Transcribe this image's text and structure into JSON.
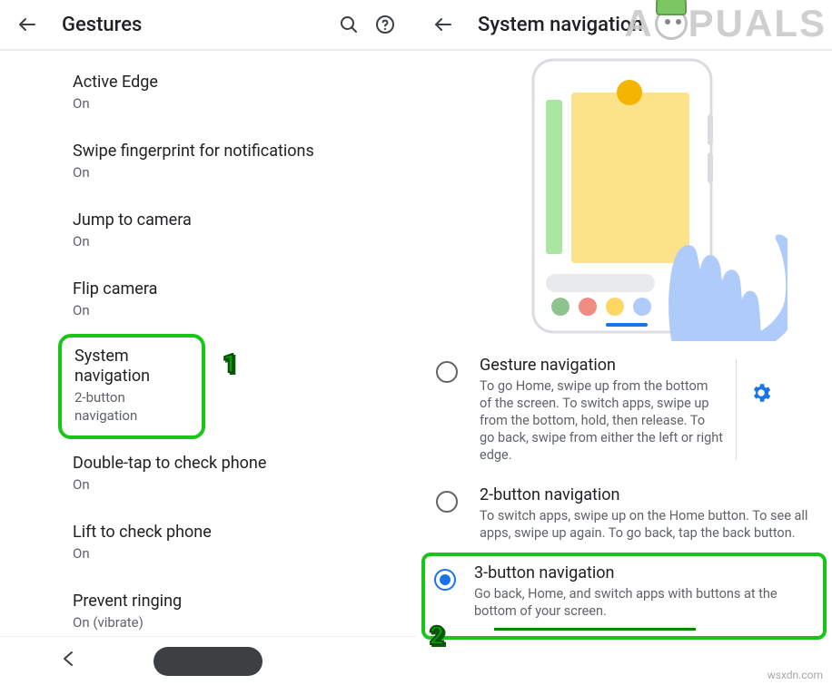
{
  "watermark": {
    "pre": "A",
    "post": "PUALS"
  },
  "footer_url": "wsxdn.com",
  "step_labels": {
    "one": "1",
    "two": "2"
  },
  "left": {
    "title": "Gestures",
    "items": [
      {
        "label": "Active Edge",
        "sub": "On"
      },
      {
        "label": "Swipe fingerprint for notifications",
        "sub": "On"
      },
      {
        "label": "Jump to camera",
        "sub": "On"
      },
      {
        "label": "Flip camera",
        "sub": "On"
      },
      {
        "label": "System navigation",
        "sub": "2-button navigation",
        "highlight": true
      },
      {
        "label": "Double-tap to check phone",
        "sub": "On"
      },
      {
        "label": "Lift to check phone",
        "sub": "On"
      },
      {
        "label": "Prevent ringing",
        "sub": "On (vibrate)"
      }
    ]
  },
  "right": {
    "title": "System navigation",
    "options": [
      {
        "title": "Gesture navigation",
        "desc": "To go Home, swipe up from the bottom of the screen. To switch apps, swipe up from the bottom, hold, then release. To go back, swipe from either the left or right edge.",
        "checked": false,
        "has_settings": true
      },
      {
        "title": "2-button navigation",
        "desc": "To switch apps, swipe up on the Home button. To see all apps, swipe up again. To go back, tap the back button.",
        "checked": false
      },
      {
        "title": "3-button navigation",
        "desc": "Go back, Home, and switch apps with buttons at the bottom of your screen.",
        "checked": true,
        "highlight": true
      }
    ]
  }
}
